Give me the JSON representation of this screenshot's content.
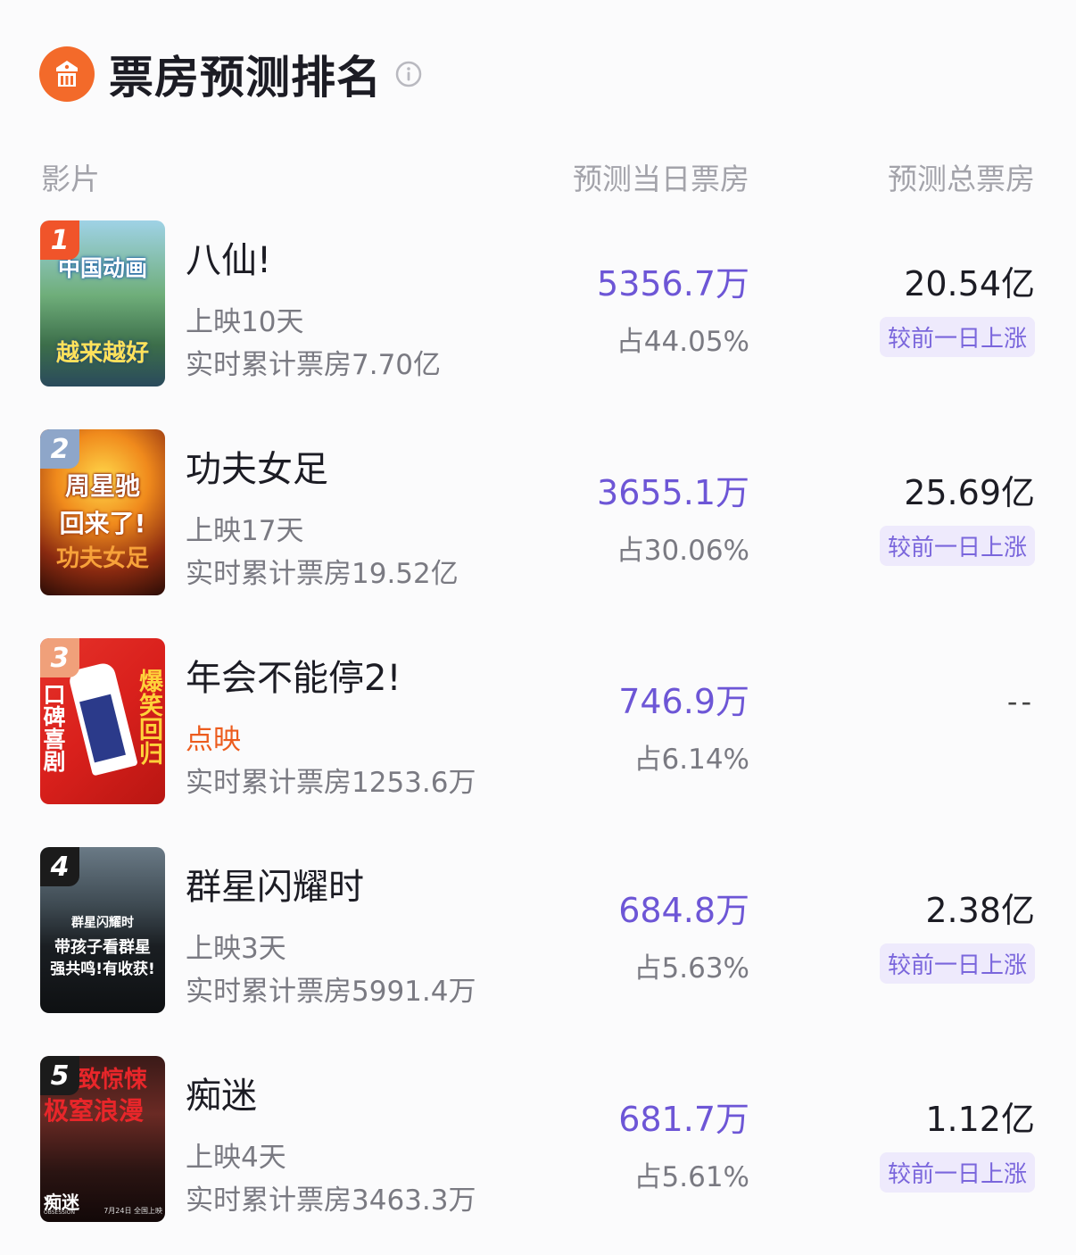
{
  "header": {
    "title": "票房预测排名"
  },
  "columns": {
    "film": "影片",
    "day_forecast": "预测当日票房",
    "total_forecast": "预测总票房"
  },
  "movies": [
    {
      "rank": "1",
      "name": "八仙!",
      "release": "上映10天",
      "cumulative": "实时累计票房7.70亿",
      "day_box": "5356.7万",
      "share": "占44.05%",
      "total": "20.54亿",
      "trend": "较前一日上涨",
      "rank_color": "#f0542a",
      "poster_lines": [
        "中国动画",
        "越来越好"
      ]
    },
    {
      "rank": "2",
      "name": "功夫女足",
      "release": "上映17天",
      "cumulative": "实时累计票房19.52亿",
      "day_box": "3655.1万",
      "share": "占30.06%",
      "total": "25.69亿",
      "trend": "较前一日上涨",
      "rank_color": "#8ea6c9",
      "poster_lines": [
        "周星驰",
        "回来了!",
        "功夫女足"
      ]
    },
    {
      "rank": "3",
      "name": "年会不能停2!",
      "release": "点映",
      "cumulative": "实时累计票房1253.6万",
      "day_box": "746.9万",
      "share": "占6.14%",
      "total": "--",
      "trend": "",
      "rank_color": "#f0a07a",
      "poster_lines": [
        "口碑喜剧",
        "爆笑回归"
      ]
    },
    {
      "rank": "4",
      "name": "群星闪耀时",
      "release": "上映3天",
      "cumulative": "实时累计票房5991.4万",
      "day_box": "684.8万",
      "share": "占5.63%",
      "total": "2.38亿",
      "trend": "较前一日上涨",
      "rank_color": "#1b1b1b",
      "poster_lines": [
        "群星闪耀时",
        "带孩子看群星",
        "强共鸣!有收获!"
      ]
    },
    {
      "rank": "5",
      "name": "痴迷",
      "release": "上映4天",
      "cumulative": "实时累计票房3463.3万",
      "day_box": "681.7万",
      "share": "占5.61%",
      "total": "1.12亿",
      "trend": "较前一日上涨",
      "rank_color": "#1b1b1b",
      "poster_lines": [
        "致惊悚",
        "极窒浪漫",
        "痴迷",
        "OBSESSION",
        "7月24日 全国上映"
      ]
    }
  ],
  "colors": {
    "accent_purple": "#6d56d6",
    "brand_orange": "#f36a2a",
    "highlight_orange": "#ec5c1e",
    "trend_bg": "#eeeafc"
  }
}
